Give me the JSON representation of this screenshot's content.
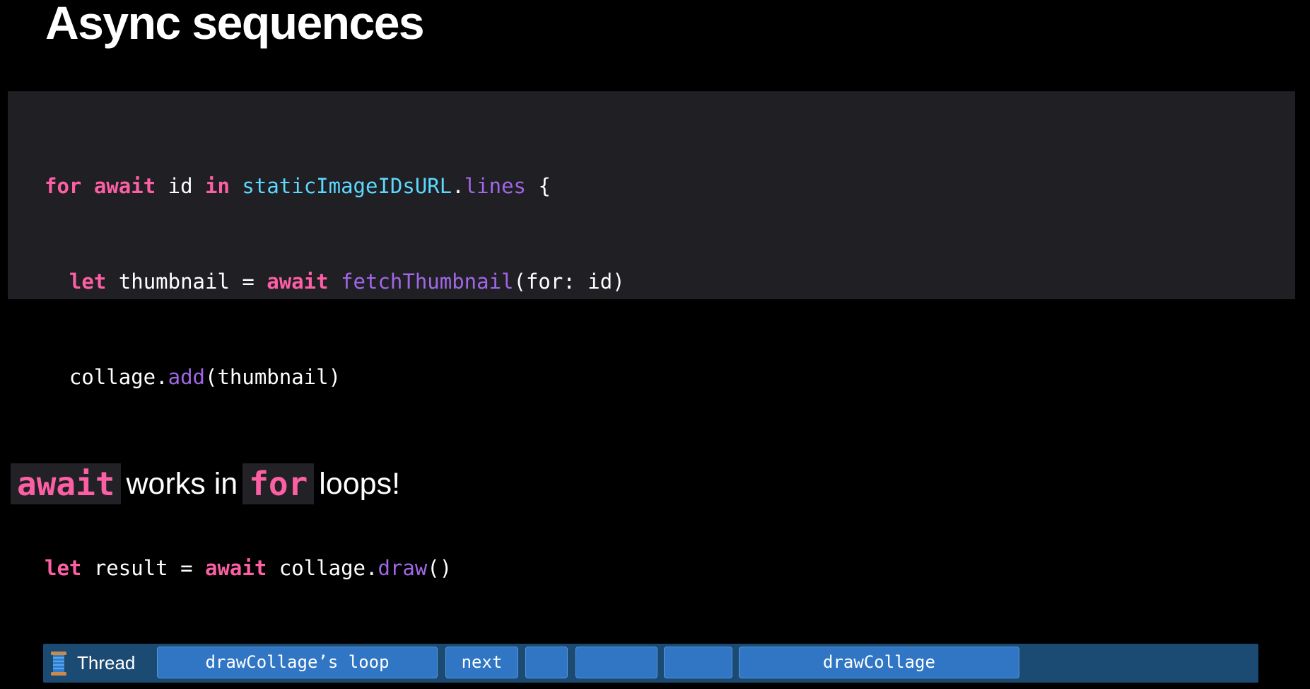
{
  "slide": {
    "title": "Async sequences"
  },
  "code": {
    "line1": {
      "kw_for": "for",
      "kw_await": "await",
      "var_id": " id ",
      "kw_in": "in",
      "sp": " ",
      "type_url": "staticImageIDsURL",
      "dot": ".",
      "prop_lines": "lines",
      "brace": " {"
    },
    "line2": {
      "indent": "  ",
      "kw_let": "let",
      "mid": " thumbnail = ",
      "kw_await": "await",
      "sp": " ",
      "fn_fetch": "fetchThumbnail",
      "args": "(for: id)"
    },
    "line3": {
      "indent": "  ",
      "obj": "collage.",
      "fn_add": "add",
      "args": "(thumbnail)"
    },
    "line4": {
      "brace": "}"
    },
    "line5": {
      "kw_let": "let",
      "mid": " result = ",
      "kw_await": "await",
      "obj": " collage.",
      "fn_draw": "draw",
      "args": "()"
    }
  },
  "caption": {
    "chip1": "await",
    "text1": "works in",
    "chip2": "for",
    "text2": "loops!"
  },
  "thread_bar": {
    "label": "Thread",
    "icon": "spool-of-thread-icon",
    "segments": [
      "drawCollage’s loop",
      "next",
      "",
      "",
      "",
      "drawCollage"
    ]
  },
  "colors": {
    "keyword": "#fc5fa3",
    "type": "#5dd8ff",
    "function": "#a167e6",
    "code_background": "#1f1f24",
    "thread_bar": "#1b4a72",
    "segment": "#3076c4"
  }
}
